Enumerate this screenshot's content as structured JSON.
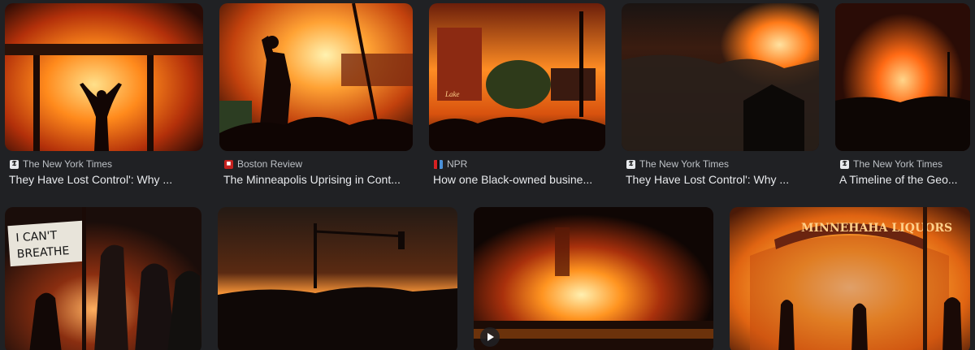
{
  "results": [
    {
      "source": "The New York Times",
      "favicon": "nyt-icon",
      "title": "They Have Lost Control': Why ..."
    },
    {
      "source": "Boston Review",
      "favicon": "boston-review-icon",
      "title": "The Minneapolis Uprising in Cont..."
    },
    {
      "source": "NPR",
      "favicon": "npr-icon",
      "title": "How one Black-owned busine..."
    },
    {
      "source": "The New York Times",
      "favicon": "nyt-icon",
      "title": "They Have Lost Control': Why ..."
    },
    {
      "source": "The New York Times",
      "favicon": "nyt-icon",
      "title": "A Timeline of the Geo..."
    }
  ],
  "image_text": {
    "sign": "I CAN'T BREATHE",
    "building_sign": "MINNEHAHA LIQUORS",
    "store_sign": "Lake"
  },
  "icons": {
    "video": "play-icon"
  },
  "colors": {
    "background": "#202124",
    "text_primary": "#e8eaed",
    "text_secondary": "#bdc1c6",
    "fire": "#ff8c1a"
  }
}
